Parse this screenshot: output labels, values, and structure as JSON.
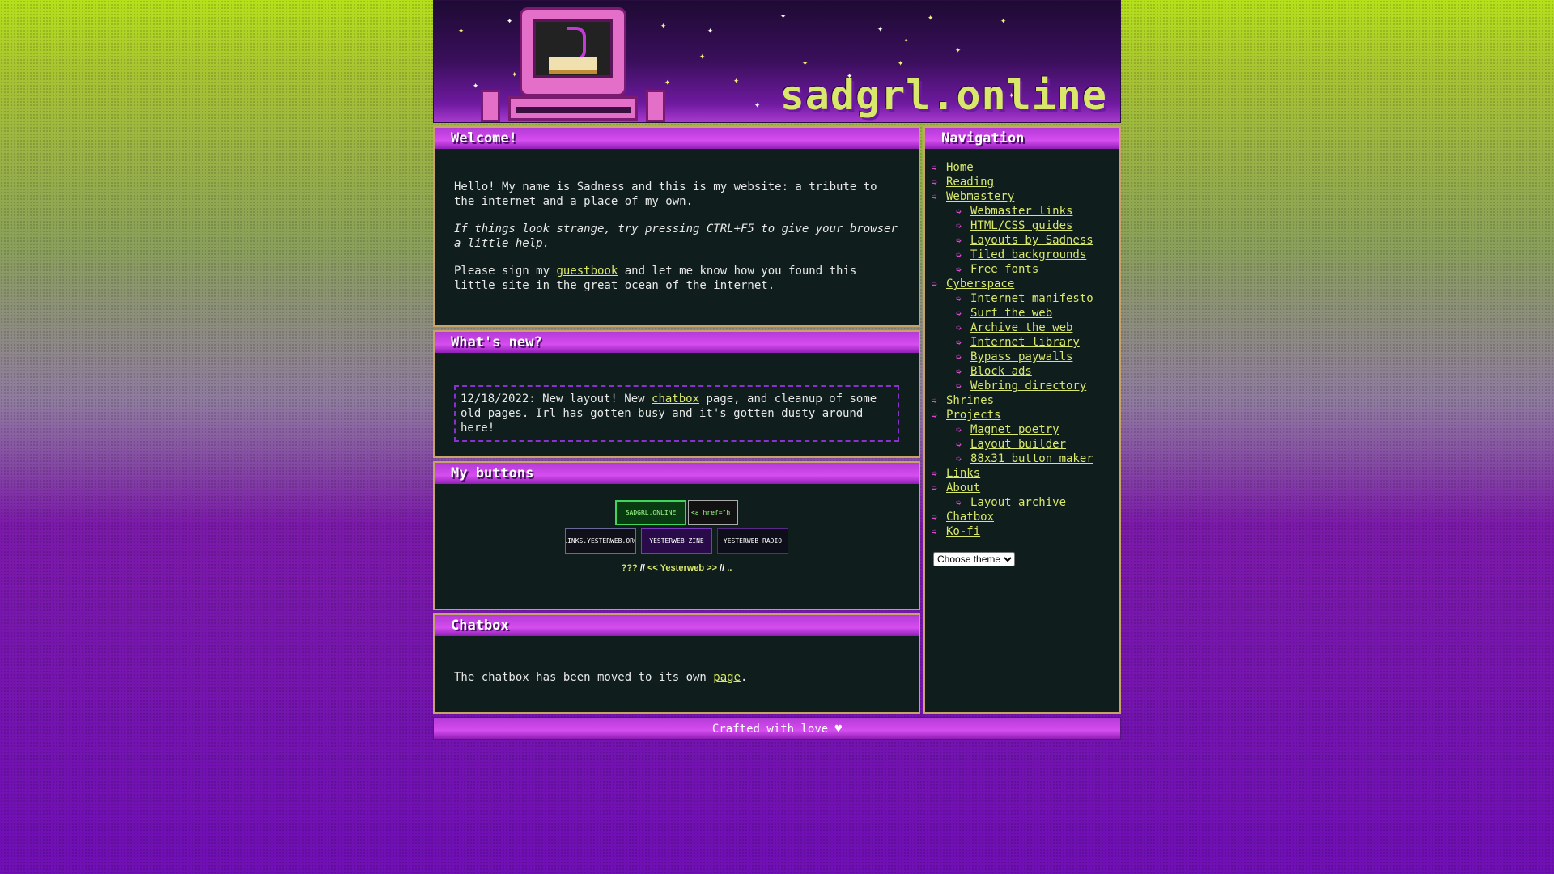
{
  "site": {
    "logo": "sadgrl.online"
  },
  "welcome": {
    "title": "Welcome!",
    "p1": "Hello! My name is Sadness and this is my website: a tribute to the internet and a place of my own.",
    "p2": "If things look strange, try pressing CTRL+F5 to give your browser a little help.",
    "p3_before": "Please sign my ",
    "p3_link": "guestbook",
    "p3_after": " and let me know how you found this little site in the great ocean of the internet."
  },
  "news": {
    "title": "What's new?",
    "before": "12/18/2022: New layout! New ",
    "link": "chatbox",
    "after": " page, and cleanup of some old pages. Irl has gotten busy and it's gotten dusty around here!"
  },
  "buttons": {
    "title": "My buttons",
    "badges": [
      "SADGRL.ONLINE",
      "<a href=\"h",
      "LINKS.YESTERWEB.ORG",
      "YESTERWEB ZINE",
      "YESTERWEB RADIO"
    ],
    "webring": {
      "prev": "???",
      "sep1": " // ",
      "name": "<< Yesterweb >>",
      "sep2": " // ",
      "next": ".."
    }
  },
  "chat": {
    "title": "Chatbox",
    "before": "The chatbox has been moved to its own ",
    "link": "page",
    "after": "."
  },
  "nav": {
    "title": "Navigation",
    "items": [
      {
        "label": "Home"
      },
      {
        "label": "Reading"
      },
      {
        "label": "Webmastery",
        "children": [
          "Webmaster links",
          "HTML/CSS guides",
          "Layouts by Sadness",
          "Tiled backgrounds",
          "Free fonts"
        ]
      },
      {
        "label": "Cyberspace",
        "children": [
          "Internet manifesto",
          "Surf the web",
          "Archive the web",
          "Internet library",
          "Bypass paywalls",
          "Block ads",
          "Webring directory"
        ]
      },
      {
        "label": "Shrines"
      },
      {
        "label": "Projects",
        "children": [
          "Magnet poetry",
          "Layout builder",
          "88x31 button maker"
        ]
      },
      {
        "label": "Links"
      },
      {
        "label": "About",
        "children": [
          "Layout archive"
        ]
      },
      {
        "label": "Chatbox"
      },
      {
        "label": "Ko-fi"
      }
    ],
    "theme_select": "Choose theme"
  },
  "footer": {
    "text": "Crafted with love ♥"
  },
  "colors": {
    "link": "#d9e86a",
    "accent": "#d64df0",
    "panel": "#0f1e1c",
    "bullet": "#e04ad8"
  },
  "icons": {
    "nav_bullet": "double-arrow-icon"
  }
}
